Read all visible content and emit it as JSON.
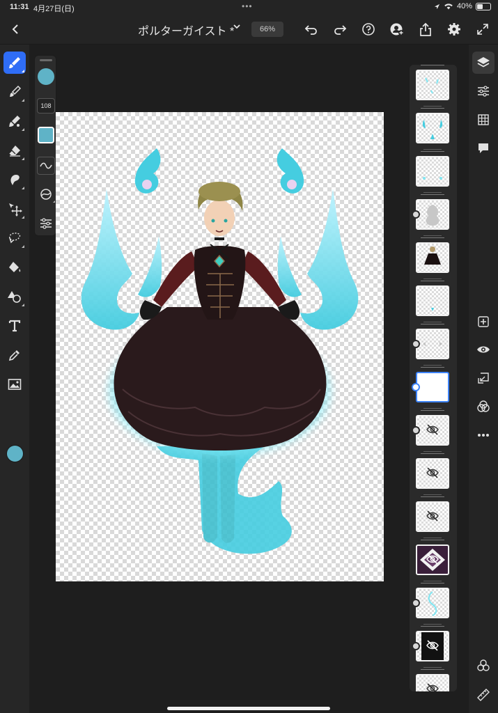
{
  "status_bar": {
    "time": "11:31",
    "date": "4月27日(日)",
    "battery": "40%",
    "battery_level": 0.4
  },
  "toolbar": {
    "document_title": "ポルターガイスト *",
    "zoom": "66%",
    "icons": [
      "chevron-left-icon",
      "chevron-down-icon",
      "undo-icon",
      "redo-icon",
      "help-icon",
      "add-user-icon",
      "share-icon",
      "gear-icon",
      "fullscreen-icon"
    ]
  },
  "tools": [
    "paint-brush",
    "pixel-brush",
    "mixer-brush",
    "eraser",
    "smudge",
    "move-transform",
    "selection-lasso",
    "fill-bucket",
    "shape",
    "text",
    "eyedropper",
    "image-place"
  ],
  "colors": {
    "accent": "#2f6df6",
    "primary_color": "#5fb3c7",
    "brush_swatch": "#5fb3c7"
  },
  "brush_panel": {
    "size": "108",
    "icons": [
      "brush-color-circle-icon",
      "brush-size-icon",
      "brush-swatch-icon",
      "stroke-smoothing-icon",
      "brush-dynamics-icon",
      "brush-settings-icon"
    ]
  },
  "layers": [
    {
      "thumb": "cyan-sparkles",
      "hidden": false,
      "mask": false,
      "selected": false
    },
    {
      "thumb": "cyan-flames-small",
      "hidden": false,
      "mask": false,
      "selected": false
    },
    {
      "thumb": "cyan-dots",
      "hidden": false,
      "mask": false,
      "selected": false
    },
    {
      "thumb": "gray-sketch",
      "hidden": false,
      "mask": true,
      "selected": false
    },
    {
      "thumb": "character-figure",
      "hidden": false,
      "mask": false,
      "selected": false
    },
    {
      "thumb": "cyan-small",
      "hidden": false,
      "mask": false,
      "selected": false
    },
    {
      "thumb": "gray-hands",
      "hidden": false,
      "mask": true,
      "selected": false
    },
    {
      "thumb": "empty",
      "hidden": false,
      "mask": true,
      "selected": true
    },
    {
      "thumb": "hidden",
      "hidden": true,
      "mask": true,
      "selected": false
    },
    {
      "thumb": "hidden",
      "hidden": true,
      "mask": false,
      "selected": false
    },
    {
      "thumb": "hidden",
      "hidden": true,
      "mask": false,
      "selected": false
    },
    {
      "thumb": "purple-pattern",
      "hidden": true,
      "mask": false,
      "selected": false
    },
    {
      "thumb": "cyan-outline",
      "hidden": false,
      "mask": true,
      "selected": false
    },
    {
      "thumb": "black-hidden",
      "hidden": true,
      "mask": true,
      "selected": false
    },
    {
      "thumb": "hidden-partial",
      "hidden": true,
      "mask": false,
      "selected": false
    }
  ],
  "right_rail": [
    "layers-icon",
    "adjustments-icon",
    "grid-icon",
    "comment-icon",
    "add-layer-icon",
    "visibility-icon",
    "merge-down-icon",
    "blend-mode-icon",
    "more-icon",
    "effects-icon",
    "ruler-icon"
  ]
}
